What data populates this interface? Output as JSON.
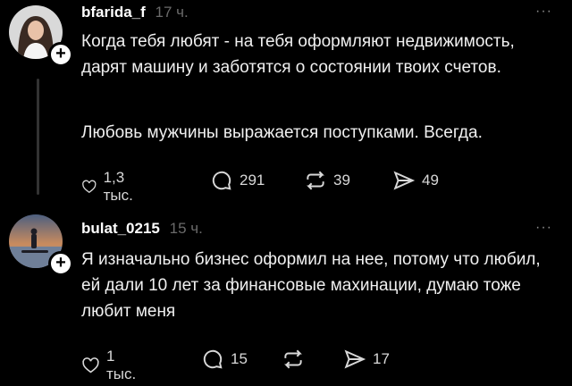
{
  "posts": [
    {
      "username": "bfarida_f",
      "time": "17 ч.",
      "paragraphs": [
        "Когда тебя любят - на тебя оформляют недвижимость, дарят машину и заботятся о состоянии твоих счетов.",
        "Любовь мужчины выражается поступками. Всегда."
      ],
      "actions": {
        "likes": "1,3 тыс.",
        "comments": "291",
        "reposts": "39",
        "shares": "49"
      }
    },
    {
      "username": "bulat_0215",
      "time": "15 ч.",
      "paragraphs": [
        "Я изначально бизнес оформил на нее, потому что любил, ей дали 10 лет за финансовые махинации, думаю тоже любит меня"
      ],
      "actions": {
        "likes": "1 тыс.",
        "comments": "15",
        "reposts": "",
        "shares": "17"
      }
    }
  ],
  "icons": {
    "more": "more-icon",
    "like": "heart-icon",
    "comment": "comment-icon",
    "repost": "repost-icon",
    "share": "share-icon",
    "follow": "plus-icon"
  },
  "follow_symbol": "+",
  "more_symbol": "···"
}
